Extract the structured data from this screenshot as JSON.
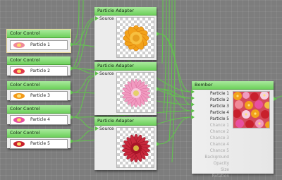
{
  "color_controls": [
    {
      "title": "Color Control",
      "label": "Particle 1",
      "color": "#f08a98"
    },
    {
      "title": "Color Control",
      "label": "Particle 2",
      "color": "#e03a4c"
    },
    {
      "title": "Color Control",
      "label": "Particle 3",
      "color": "#f29a1a"
    },
    {
      "title": "Color Control",
      "label": "Particle 4",
      "color": "#e850a0"
    },
    {
      "title": "Color Control",
      "label": "Particle 5",
      "color": "#c8202c"
    }
  ],
  "particle_adapters": [
    {
      "title": "Particle Adapter",
      "source_label": "Source",
      "flower": "orange-flower-icon"
    },
    {
      "title": "Particle Adapter",
      "source_label": "Source",
      "flower": "pink-flower-icon"
    },
    {
      "title": "Particle Adapter",
      "source_label": "Source",
      "flower": "red-flower-icon"
    }
  ],
  "bomber": {
    "title": "Bomber",
    "ports": [
      {
        "label": "Particle 1",
        "active": true
      },
      {
        "label": "Particle 2",
        "active": true
      },
      {
        "label": "Particle 3",
        "active": true
      },
      {
        "label": "Particle 4",
        "active": true
      },
      {
        "label": "Particle 5",
        "active": true
      },
      {
        "label": "Chance 1",
        "active": false
      },
      {
        "label": "Chance 2",
        "active": false
      },
      {
        "label": "Chance 3",
        "active": false
      },
      {
        "label": "Chance 4",
        "active": false
      },
      {
        "label": "Chance 5",
        "active": false
      },
      {
        "label": "Background",
        "active": false
      },
      {
        "label": "Opacity",
        "active": false
      },
      {
        "label": "Size",
        "active": false
      },
      {
        "label": "Rotation",
        "active": false
      }
    ]
  },
  "colors": {
    "wire": "#5ec14a",
    "header": "#7fd86c",
    "canvas": "#7d7d7d"
  }
}
